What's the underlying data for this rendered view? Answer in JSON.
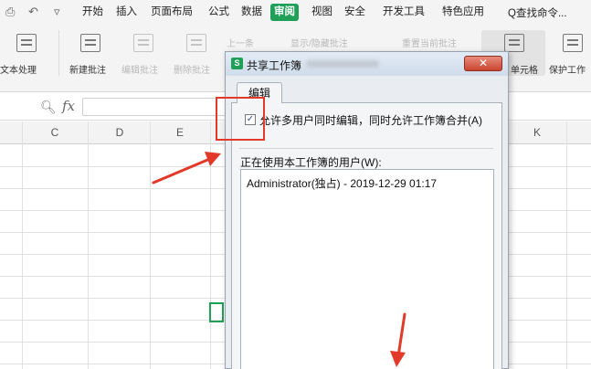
{
  "menubar": {
    "tabs": [
      "开始",
      "插入",
      "页面布局",
      "公式",
      "数据",
      "审阅",
      "视图",
      "安全",
      "开发工具",
      "特色应用"
    ],
    "active_tab": "审阅",
    "search_command": "Q查找命令..."
  },
  "ribbon": {
    "text_process": "文本处理",
    "new_comment": "新建批注",
    "edit_comment": "编辑批注",
    "delete_comment": "删除批注",
    "prev": "上一条",
    "show_hide_comments": "显示/隐藏批注",
    "reset_comment": "重置当前批注",
    "protect_cell": "单元格",
    "protect_workbook": "保护工作"
  },
  "formula_bar": {
    "fx": "fx"
  },
  "sheet": {
    "columns": [
      "C",
      "D",
      "E",
      "K"
    ]
  },
  "dialog": {
    "title": "共享工作簿",
    "app_badge": "S",
    "close_glyph": "✕",
    "tab": "编辑",
    "checkbox_label": "允许多用户同时编辑，同时允许工作簿合并(A)",
    "checkbox_checked": true,
    "users_label": "正在使用本工作簿的用户(W):",
    "users": [
      "Administrator(独占) - 2019-12-29 01:17"
    ]
  },
  "colors": {
    "accent": "#1f9f57",
    "annotation": "#e23a2a"
  }
}
